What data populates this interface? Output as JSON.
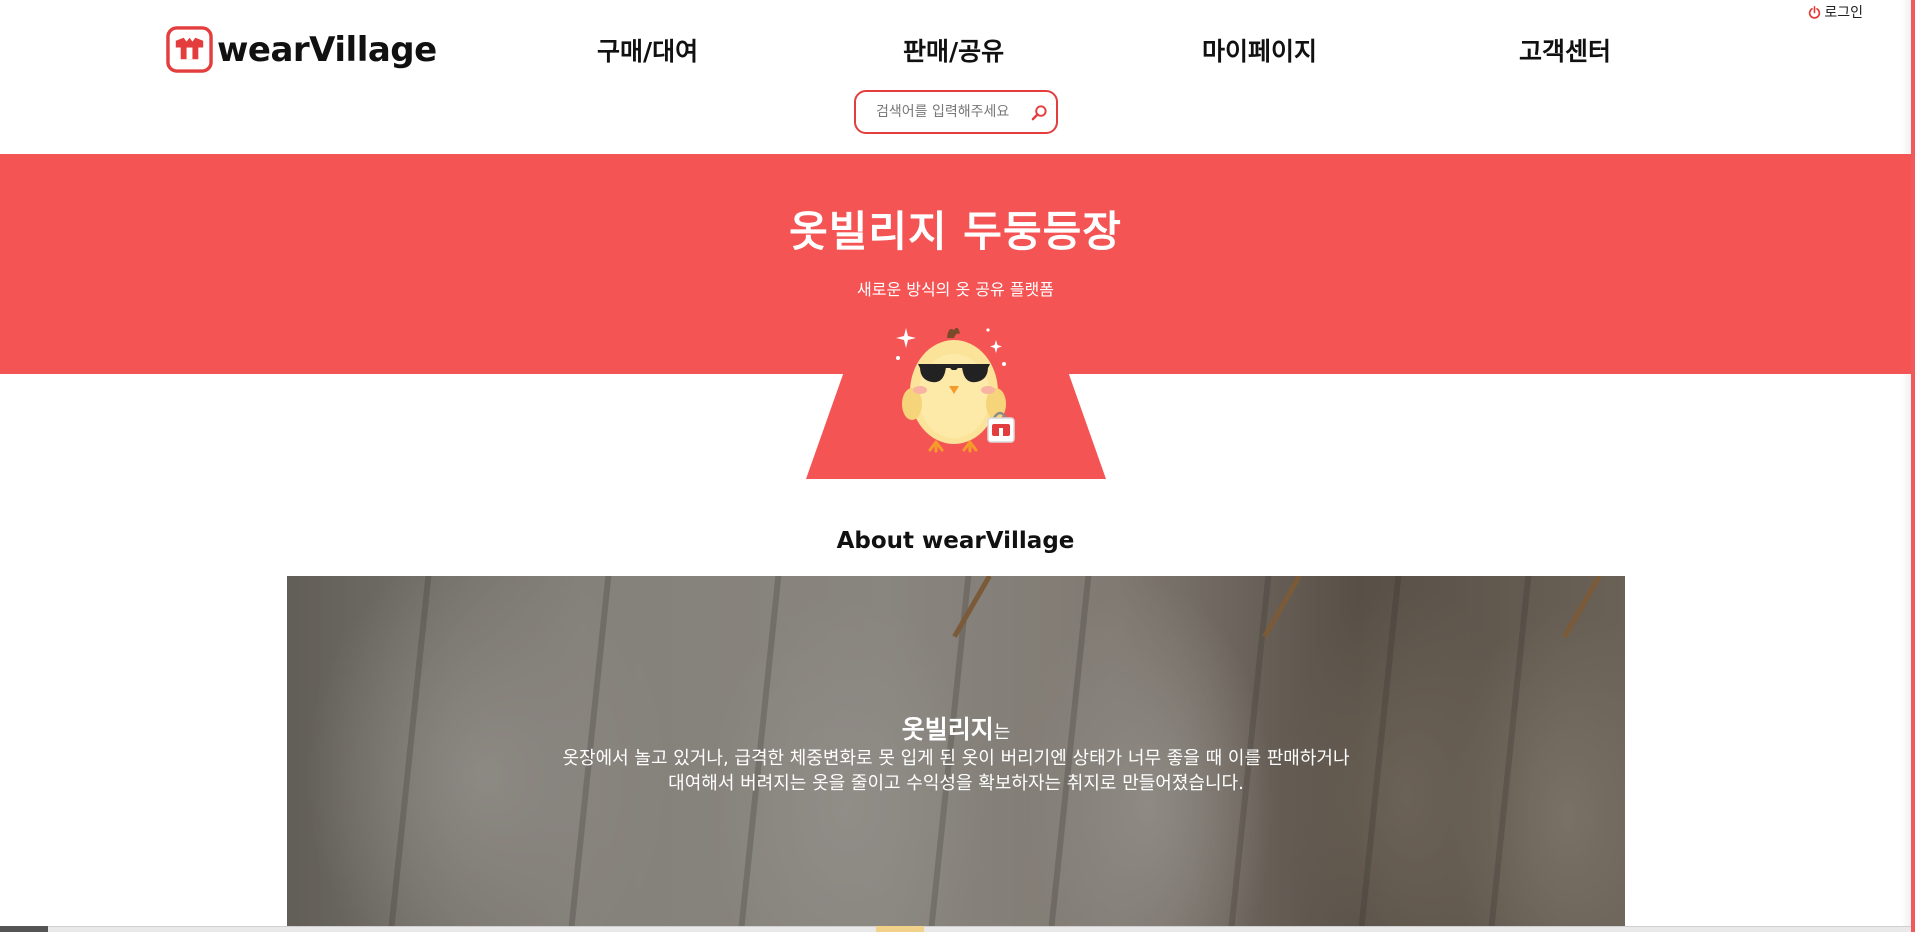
{
  "header": {
    "login_label": "로그인",
    "logo_text": "wearVillage",
    "nav": [
      {
        "label": "구매/대여"
      },
      {
        "label": "판매/공유"
      },
      {
        "label": "마이페이지"
      },
      {
        "label": "고객센터"
      }
    ],
    "search": {
      "placeholder": "검색어를 입력해주세요",
      "value": ""
    }
  },
  "hero": {
    "title": "옷빌리지 두둥등장",
    "subtitle": "새로운 방식의 옷 공유 플랫폼"
  },
  "about": {
    "title": "About wearVillage",
    "lead": "옷빌리지",
    "lead_suffix": "는",
    "line1": "옷장에서 놀고 있거나, 급격한 체중변화로 못 입게 된 옷이 버리기엔 상태가 너무 좋을 때 이를 판매하거나",
    "line2": "대여해서 버려지는 옷을 줄이고 수익성을 확보하자는 취지로 만들어졌습니다."
  },
  "colors": {
    "accent": "#f55454",
    "search_border": "#e33d3d",
    "power_icon": "#e53935"
  },
  "icons": {
    "logo": "shirt-logo-icon",
    "login": "power-icon",
    "search": "search-icon",
    "mascot": "chick-mascot-icon"
  }
}
